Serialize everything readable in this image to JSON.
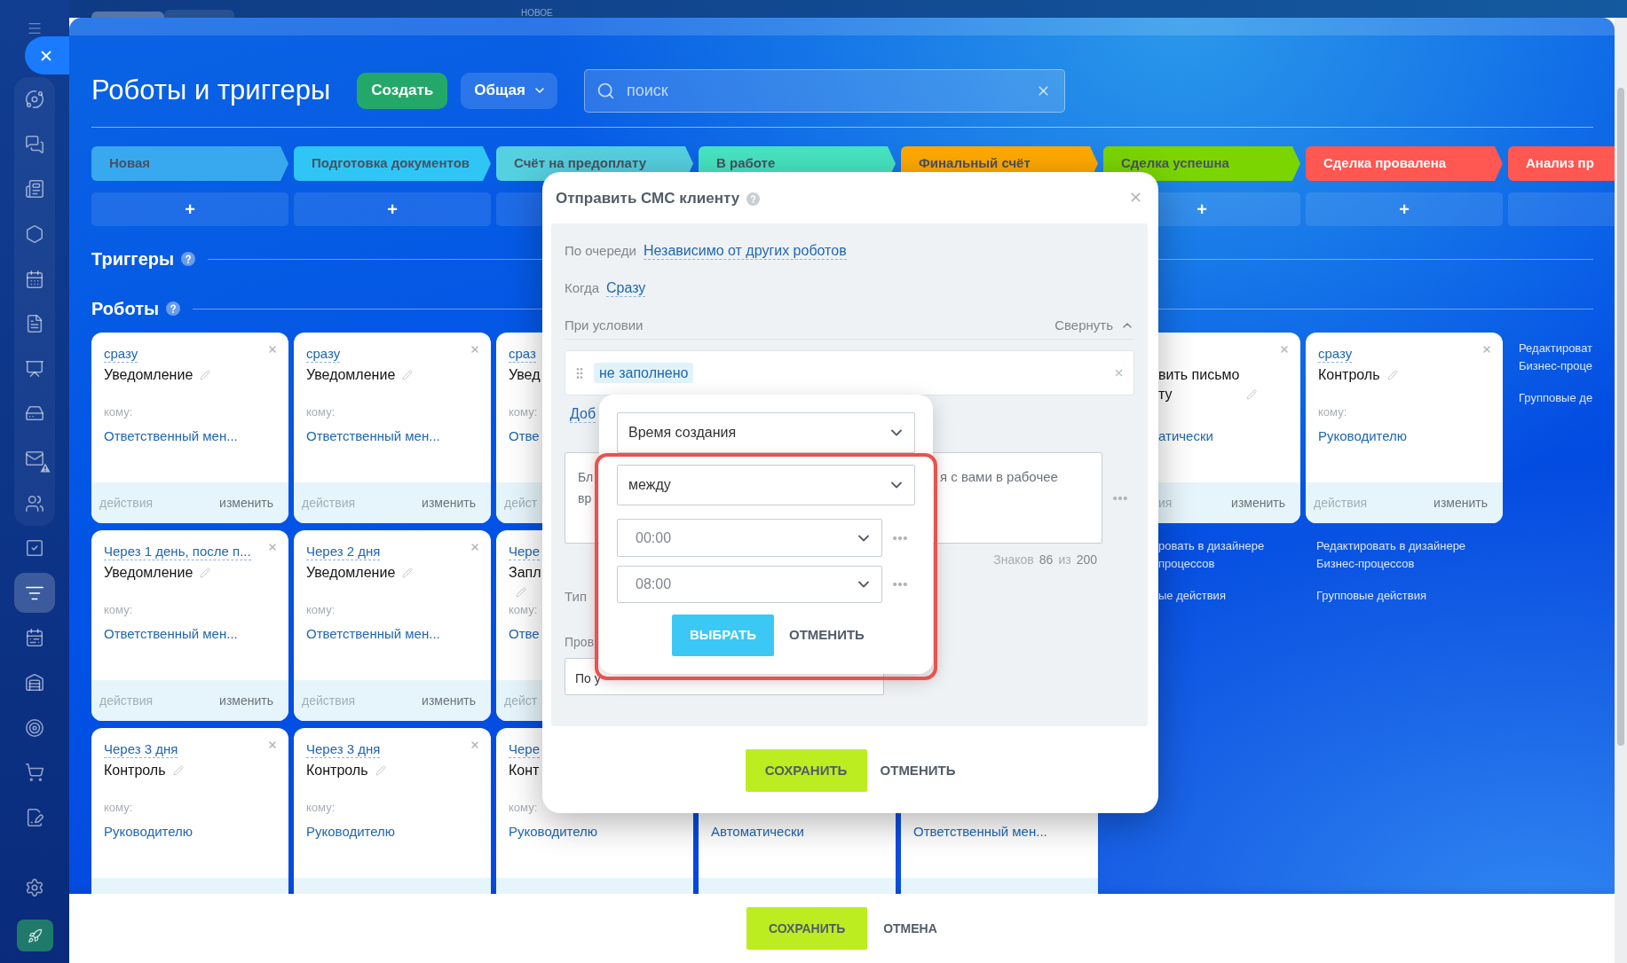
{
  "top_strip": {
    "label": "НОВОЕ"
  },
  "sidebar": {
    "items": [
      {
        "selected": false,
        "alert": false
      },
      {
        "selected": false,
        "alert": false
      },
      {
        "selected": false,
        "alert": false
      },
      {
        "selected": false,
        "alert": false
      },
      {
        "selected": false,
        "alert": false
      },
      {
        "selected": false,
        "alert": false
      },
      {
        "selected": false,
        "alert": false
      },
      {
        "selected": false,
        "alert": false
      },
      {
        "selected": false,
        "alert": true
      },
      {
        "selected": false,
        "alert": false
      },
      {
        "selected": false,
        "alert": false
      },
      {
        "selected": true,
        "alert": false
      },
      {
        "selected": false,
        "alert": false
      },
      {
        "selected": false,
        "alert": false
      },
      {
        "selected": false,
        "alert": false
      },
      {
        "selected": false,
        "alert": false
      },
      {
        "selected": false,
        "alert": false
      }
    ]
  },
  "header": {
    "title": "Роботы и триггеры",
    "create_button": "Создать",
    "category_button": "Общая",
    "search": {
      "placeholder": "поиск"
    }
  },
  "stages": [
    {
      "name": "Новая",
      "color": "#39a9ef",
      "add_label": "+"
    },
    {
      "name": "Подготовка документов",
      "color": "#2fc6f6",
      "add_label": "+"
    },
    {
      "name": "Счёт на предоплату",
      "color": "#55d0e0"
    },
    {
      "name": "В работе",
      "color": "#47e4c2"
    },
    {
      "name": "Финальный счёт",
      "color": "#ffa900"
    },
    {
      "name": "Сделка успешна",
      "color": "#7bd500",
      "add_label": "+"
    },
    {
      "name": "Сделка провалена",
      "color": "#ff5752",
      "add_label": "+"
    },
    {
      "name": "Анализ пр",
      "color": "#ff5752"
    }
  ],
  "triggers": {
    "title": "Триггеры"
  },
  "robots": {
    "title": "Роботы"
  },
  "robot_columns": [
    {
      "robots": [
        {
          "timing": "сразу",
          "name": [
            "Уведомление"
          ],
          "pencil": true,
          "to_label": "кому:",
          "to": "Ответственный мен...",
          "actions": "действия",
          "edit": "изменить",
          "close": true
        },
        {
          "timing": "Через 1 день, после п...",
          "name": [
            "Уведомление"
          ],
          "pencil": true,
          "to_label": "кому:",
          "to": "Ответственный мен...",
          "actions": "действия",
          "edit": "изменить",
          "close": true
        },
        {
          "timing": "Через 3 дня",
          "name": [
            "Контроль"
          ],
          "pencil": true,
          "to_label": "кому:",
          "to": "Руководителю",
          "close": true
        }
      ]
    },
    {
      "robots": [
        {
          "timing": "сразу",
          "name": [
            "Уведомление"
          ],
          "pencil": true,
          "to_label": "кому:",
          "to": "Ответственный мен...",
          "actions": "действия",
          "edit": "изменить",
          "close": true
        },
        {
          "timing": "Через 2 дня",
          "name": [
            "Уведомление"
          ],
          "pencil": true,
          "to_label": "кому:",
          "to": "Ответственный мен...",
          "actions": "действия",
          "edit": "изменить",
          "close": true
        },
        {
          "timing": "Через 3 дня",
          "name": [
            "Контроль"
          ],
          "pencil": true,
          "to_label": "кому:",
          "to": "Руководителю",
          "close": true
        }
      ]
    },
    {
      "robots": [
        {
          "timing": "сраз",
          "name": [
            "Увед"
          ],
          "pencil": false,
          "to_label": "кому:",
          "to": "Отве",
          "actions": "дейст",
          "close": false
        },
        {
          "timing": "Чере",
          "name": [
            "Запл"
          ],
          "pencil": true,
          "to_label": "кому:",
          "to": "Отве",
          "actions": "дейст",
          "close": false
        },
        {
          "timing": "Чере",
          "name": [
            "Конт"
          ],
          "pencil": false,
          "to_label": "кому:",
          "to": "Руководителю",
          "close": false
        }
      ]
    },
    {
      "robots": [
        {
          "pencil": false,
          "to": "Автоматически",
          "close": false
        }
      ]
    },
    {
      "robots": [
        {
          "pencil": false,
          "to": "Ответственный мен...",
          "close": false
        }
      ]
    },
    {
      "robots": [
        {
          "name": [
            "вить письмо",
            "ту"
          ],
          "pencil": true,
          "to": "атически",
          "actions": "ия",
          "edit": "изменить",
          "close": true
        }
      ],
      "links": {
        "designer": [
          "ровать в дизайнере",
          "процессов"
        ],
        "group": "ые действия"
      }
    },
    {
      "robots": [
        {
          "timing": "сразу",
          "name": [
            "Контроль"
          ],
          "pencil": true,
          "to_label": "кому:",
          "to": "Руководителю",
          "actions": "действия",
          "edit": "изменить",
          "close": true
        }
      ],
      "links": {
        "designer": [
          "Редактировать в дизайнере",
          "Бизнес-процессов"
        ],
        "group": "Групповые действия"
      }
    },
    {
      "links": {
        "designer": [
          "Редактироват",
          "Бизнес-проце"
        ],
        "group": "Групповые де"
      }
    }
  ],
  "dialog": {
    "title": "Отправить СМС клиенту",
    "fields": [
      {
        "label": "По очереди",
        "value": "Независимо от других роботов"
      },
      {
        "label": "Когда",
        "value": "Сразу"
      }
    ],
    "condition": {
      "label": "При условии",
      "toggle": "Свернуть",
      "expanded": true,
      "chip": "не заполнено",
      "add_link": "Доб"
    },
    "message": {
      "left_fragment": [
        "Бл",
        "вр"
      ],
      "right_fragment": "я с вами в рабочее",
      "counter": {
        "label": "Знаков",
        "count": "86",
        "separator": "из",
        "limit": "200"
      }
    },
    "type_label": "Тип",
    "provider_label": "Пров",
    "provider_select": "По у",
    "buttons": [
      {
        "label": "СОХРАНИТЬ",
        "kind": "primary"
      },
      {
        "label": "ОТМЕНИТЬ",
        "kind": "plain"
      }
    ]
  },
  "condition_popup": {
    "highlighted": true,
    "field": "Время создания",
    "operator": "между",
    "times": [
      "00:00",
      "08:00"
    ],
    "buttons": [
      {
        "label": "ВЫБРАТЬ",
        "kind": "primary"
      },
      {
        "label": "ОТМЕНИТЬ",
        "kind": "plain"
      }
    ]
  },
  "footer": {
    "buttons": [
      {
        "label": "СОХРАНИТЬ",
        "kind": "primary"
      },
      {
        "label": "ОТМЕНА",
        "kind": "plain"
      }
    ]
  }
}
